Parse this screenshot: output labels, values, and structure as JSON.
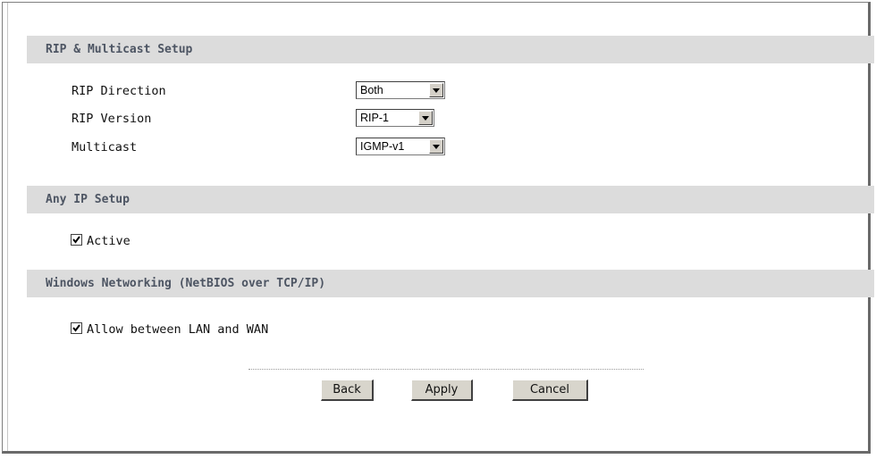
{
  "sections": {
    "rip": {
      "title": "RIP & Multicast Setup"
    },
    "anyip": {
      "title": "Any IP Setup"
    },
    "netbios": {
      "title": "Windows Networking (NetBIOS over TCP/IP)"
    }
  },
  "rip": {
    "direction": {
      "label": "RIP Direction",
      "value": "Both"
    },
    "version": {
      "label": "RIP Version",
      "value": "RIP-1"
    },
    "multicast": {
      "label": "Multicast",
      "value": "IGMP-v1"
    }
  },
  "anyip": {
    "active_label": "Active",
    "active_checked": true
  },
  "netbios": {
    "allow_label": "Allow between LAN and WAN",
    "allow_checked": true
  },
  "buttons": {
    "back": "Back",
    "apply": "Apply",
    "cancel": "Cancel"
  }
}
